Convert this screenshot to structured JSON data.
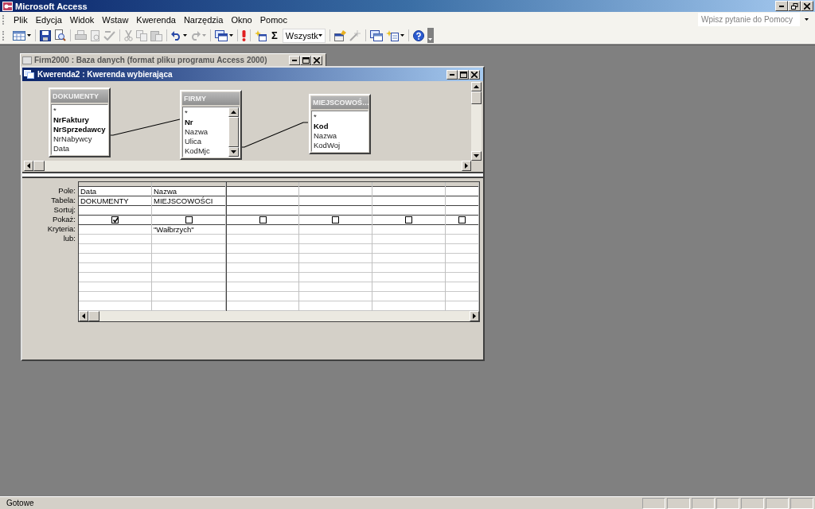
{
  "app_title": "Microsoft Access",
  "menu": [
    {
      "label": "Plik"
    },
    {
      "label": "Edycja"
    },
    {
      "label": "Widok"
    },
    {
      "label": "Wstaw"
    },
    {
      "label": "Kwerenda"
    },
    {
      "label": "Narzędzia"
    },
    {
      "label": "Okno"
    },
    {
      "label": "Pomoc"
    }
  ],
  "help_box": {
    "placeholder": "Wpisz pytanie do Pomocy"
  },
  "toolbar": {
    "totals_symbol": "Σ",
    "top_values_combo": "Wszystk"
  },
  "background_window": {
    "title": "Firm2000 : Baza danych (format pliku programu Access 2000)"
  },
  "query_window": {
    "title": "Kwerenda2 : Kwerenda wybierająca",
    "tables": [
      {
        "name": "DOKUMENTY",
        "scrollbar": false,
        "fields": [
          {
            "name": "*",
            "key": false
          },
          {
            "name": "NrFaktury",
            "key": true
          },
          {
            "name": "NrSprzedawcy",
            "key": true
          },
          {
            "name": "NrNabywcy",
            "key": false
          },
          {
            "name": "Data",
            "key": false
          }
        ]
      },
      {
        "name": "FIRMY",
        "scrollbar": true,
        "fields": [
          {
            "name": "*",
            "key": false
          },
          {
            "name": "Nr",
            "key": true
          },
          {
            "name": "Nazwa",
            "key": false
          },
          {
            "name": "Ulica",
            "key": false
          },
          {
            "name": "KodMjc",
            "key": false
          }
        ]
      },
      {
        "name": "MIEJSCOWOŚ…",
        "scrollbar": false,
        "fields": [
          {
            "name": "*",
            "key": false
          },
          {
            "name": "Kod",
            "key": true
          },
          {
            "name": "Nazwa",
            "key": false
          },
          {
            "name": "KodWoj",
            "key": false
          }
        ]
      }
    ],
    "row_labels": [
      "Pole:",
      "Tabela:",
      "Sortuj:",
      "Pokaż:",
      "Kryteria:",
      "lub:"
    ],
    "columns": [
      {
        "field": "Data",
        "table": "DOKUMENTY",
        "show": true
      },
      {
        "field": "Nazwa",
        "table": "MIEJSCOWOŚCI",
        "show": false,
        "criteria": "\"Wałbrzych\""
      },
      {
        "show": false
      },
      {
        "show": false
      },
      {
        "show": false
      },
      {
        "show": false
      }
    ]
  },
  "status_bar": {
    "text": "Gotowe"
  }
}
